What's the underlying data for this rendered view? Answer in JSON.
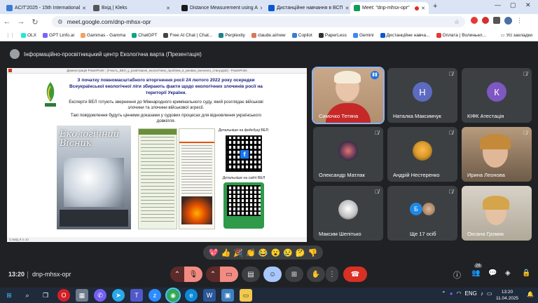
{
  "tabs": [
    {
      "title": "ACIT'2025 - 15th International",
      "color": "#3a7bd5"
    },
    {
      "title": "Вхід | Kleks",
      "color": "#444"
    },
    {
      "title": "Distance Measurement using A",
      "color": "#1a1a1a"
    },
    {
      "title": "Дистанційне навчання в ВСП",
      "color": "#0b57d0"
    },
    {
      "title": "Meet: \"dnp-mhsx-opr\"",
      "color": "#0f9d58"
    }
  ],
  "address": {
    "url": "meet.google.com/dnp-mhsx-opr"
  },
  "bookmarks": [
    {
      "label": "OLX",
      "color": "#23e5db"
    },
    {
      "label": "GPT Linfo.ai",
      "color": "#7b61ff"
    },
    {
      "label": "Gammas - Gamma",
      "color": "#f4a261"
    },
    {
      "label": "ChatGPT",
      "color": "#10a37f"
    },
    {
      "label": "Free AI Chat | Chat...",
      "color": "#444"
    },
    {
      "label": "Perplexity",
      "color": "#20808d"
    },
    {
      "label": "claude.ai/new",
      "color": "#d97757"
    },
    {
      "label": "Copilot",
      "color": "#3a7bd5"
    },
    {
      "label": "PaperLess",
      "color": "#333"
    },
    {
      "label": "Gemini",
      "color": "#4285f4"
    },
    {
      "label": "Дистанційне навча...",
      "color": "#0b57d0"
    },
    {
      "label": "Оплата | Волиньел...",
      "color": "#e53935"
    }
  ],
  "bookmarks_all": "Усі закладки",
  "meeting": {
    "presenter_title": "Інформаційно-просвітницький центр Екологічна варта (Презентація)"
  },
  "ppt": {
    "titlebar": "Демонстрація PowerPoint - [Участь_ВЕЛ_у_розв'язанні_екологічних_проблем_в_умовах_воєнного_стану.pptx] - PowerPoint",
    "status": "Слайд 9 із 10",
    "heading": "З початку повномасштабного вторгнення росії 24 лютого 2022 року осередки Всеукраїнської екологічної ліги збирають факти щодо екологічних злочинів росії на території України.",
    "para1": "Експерти ВЕЛ готують звернення до Міжнародного кримінального суду, який розглядає військові злочини та злочини військової агресії.",
    "para2": "Такі повідомлення будуть цінними доказами у судових процесах для відновлення українського довкілля.",
    "magazine_title": "Екологічний Вісник",
    "fb_label": "Детальніше на фейсбуці ВЕЛ:",
    "site_label": "Детальніше на сайті ВЕЛ"
  },
  "participants": [
    {
      "name": "Симочко Тетяна",
      "initial": "",
      "color": "#caa080",
      "photo": true
    },
    {
      "name": "Наталка Максимчук",
      "initial": "Н",
      "color": "#5c6bc0"
    },
    {
      "name": "КІФК Атестація",
      "initial": "К",
      "color": "#7e57c2"
    },
    {
      "name": "Олександр Матлак",
      "initial": "",
      "color": "#3b2a4a",
      "photo": true
    },
    {
      "name": "Андрій Нестеренко",
      "initial": "",
      "color": "#d89a2b",
      "photo": true
    },
    {
      "name": "Ирина Леонова",
      "initial": "",
      "color": "#8a6a4a",
      "photo": true
    },
    {
      "name": "Максим Шепітько",
      "initial": "",
      "color": "#eee",
      "photo": true
    },
    {
      "name": "Ще 17 осіб",
      "initial": "Б",
      "color": "#1e88e5"
    },
    {
      "name": "Оксана Громик",
      "initial": "",
      "color": "#c9c1b6",
      "photo": true
    }
  ],
  "reactions": [
    "💖",
    "👍",
    "🎉",
    "👏",
    "😂",
    "😮",
    "😢",
    "🤔",
    "👎"
  ],
  "controls": {
    "time": "13:20",
    "meeting_code": "dnp-mhsx-opr",
    "participant_count": "26"
  },
  "taskbar": {
    "time": "13:20",
    "date": "11.04.2025",
    "lang": "ENG"
  }
}
